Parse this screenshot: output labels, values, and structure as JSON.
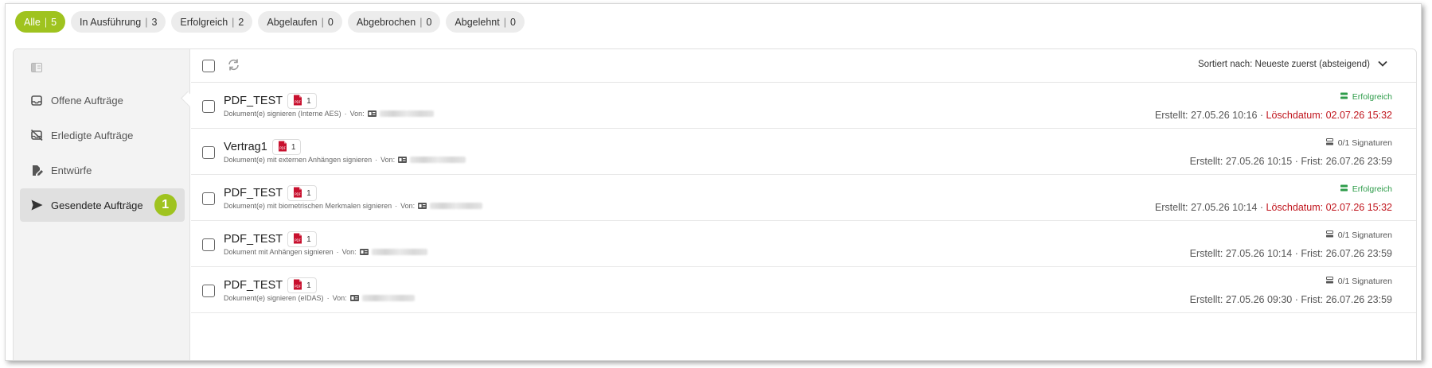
{
  "filters": [
    {
      "label": "Alle",
      "count": "5",
      "active": true
    },
    {
      "label": "In Ausführung",
      "count": "3"
    },
    {
      "label": "Erfolgreich",
      "count": "2"
    },
    {
      "label": "Abgelaufen",
      "count": "0"
    },
    {
      "label": "Abgebrochen",
      "count": "0"
    },
    {
      "label": "Abgelehnt",
      "count": "0"
    }
  ],
  "sidebar": {
    "items": [
      {
        "label": "Offene Aufträge",
        "icon": "inbox-icon"
      },
      {
        "label": "Erledigte Aufträge",
        "icon": "inbox-crossed-icon"
      },
      {
        "label": "Entwürfe",
        "icon": "draft-edit-icon"
      },
      {
        "label": "Gesendete Aufträge",
        "icon": "send-icon",
        "active": true,
        "badge": "1"
      }
    ]
  },
  "toolbar": {
    "sort_label": "Sortiert nach: Neueste zuerst (absteigend)"
  },
  "rows": [
    {
      "name": "PDF_TEST",
      "pdf_count": "1",
      "subtitle": "Dokument(e) signieren (Interne AES)",
      "from": "Von:",
      "status": "Erfolgreich",
      "created": "Erstellt: 27.05.26 10:16",
      "deadline_label": "Löschdatum: 02.07.26 15:32"
    },
    {
      "name": "Vertrag1",
      "pdf_count": "1",
      "subtitle": "Dokument(e) mit externen Anhängen signieren",
      "from": "Von:",
      "status": "0/1 Signaturen",
      "created": "Erstellt: 27.05.26 10:15",
      "deadline_label": "Frist: 26.07.26 23:59"
    },
    {
      "name": "PDF_TEST",
      "pdf_count": "1",
      "subtitle": "Dokument(e) mit biometrischen Merkmalen signieren",
      "from": "Von:",
      "status": "Erfolgreich",
      "created": "Erstellt: 27.05.26 10:14",
      "deadline_label": "Löschdatum: 02.07.26 15:32"
    },
    {
      "name": "PDF_TEST",
      "pdf_count": "1",
      "subtitle": "Dokument mit Anhängen signieren",
      "from": "Von:",
      "status": "0/1 Signaturen",
      "created": "Erstellt: 27.05.26 10:14",
      "deadline_label": "Frist: 26.07.26 23:59"
    },
    {
      "name": "PDF_TEST",
      "pdf_count": "1",
      "subtitle": "Dokument(e) signieren (eIDAS)",
      "from": "Von:",
      "status": "0/1 Signaturen",
      "created": "Erstellt: 27.05.26 09:30",
      "deadline_label": "Frist: 26.07.26 23:59"
    }
  ],
  "colors": {
    "accent": "#9fc31f",
    "success": "#2e9c4a",
    "danger": "#c0141c",
    "pdf_red": "#c8102e"
  }
}
